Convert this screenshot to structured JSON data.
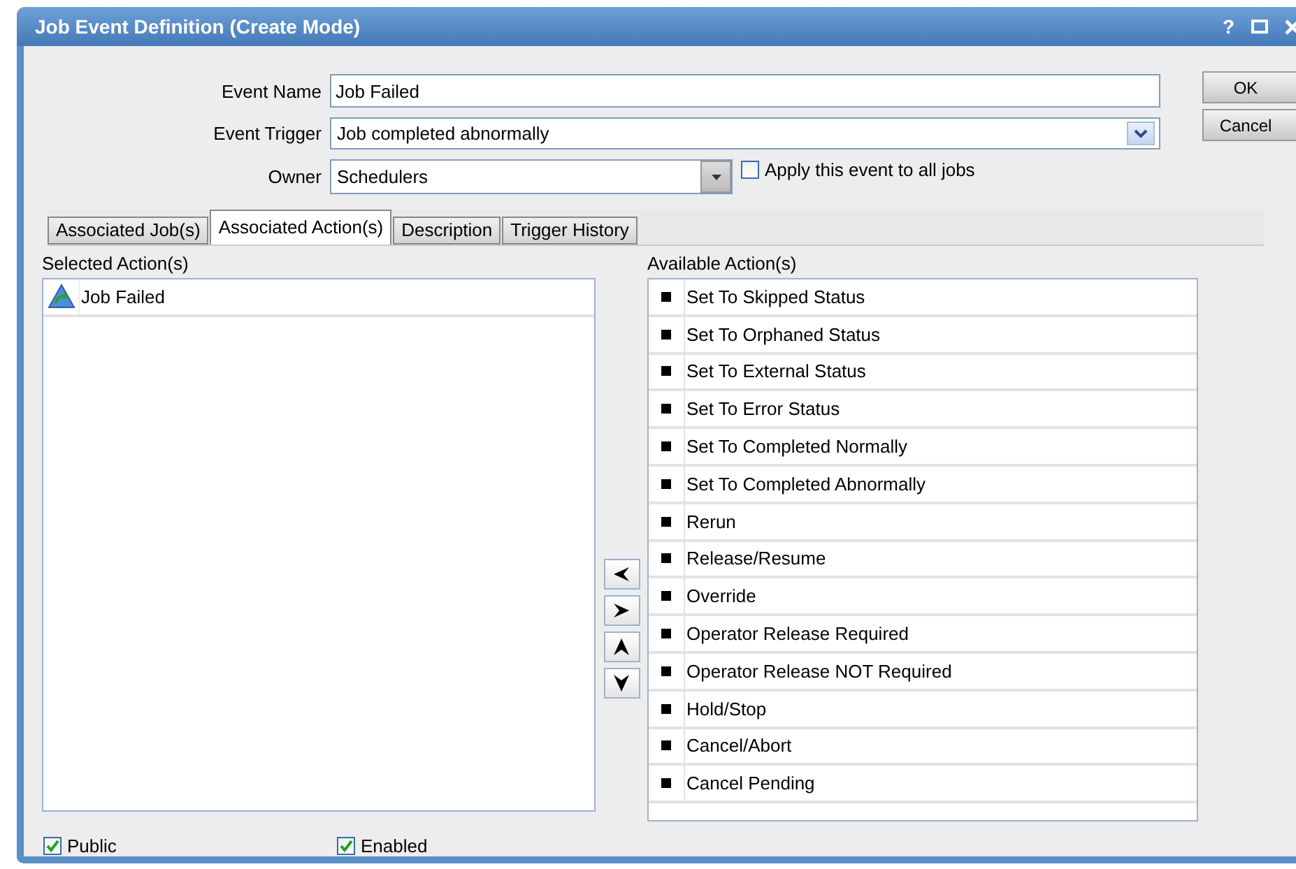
{
  "window": {
    "title": "Job Event Definition (Create Mode)",
    "help": "?"
  },
  "event_name": {
    "label": "Event Name",
    "value": "Job Failed"
  },
  "event_trigger": {
    "label": "Event Trigger",
    "value": "Job completed abnormally"
  },
  "owner": {
    "label": "Owner",
    "value": "Schedulers"
  },
  "apply_to_all": {
    "label": "Apply this event to all jobs",
    "checked": false
  },
  "buttons": [
    "OK",
    "Cancel"
  ],
  "tabs": [
    {
      "label": "Associated Job(s)",
      "selected": false
    },
    {
      "label": "Associated Action(s)",
      "selected": true
    },
    {
      "label": "Description",
      "selected": false
    },
    {
      "label": "Trigger History",
      "selected": false
    }
  ],
  "selected_actions": {
    "label": "Selected Action(s)",
    "items": [
      "Job Failed"
    ]
  },
  "available_actions": {
    "label": "Available Action(s)",
    "items": [
      "Set To Skipped Status",
      "Set To Orphaned Status",
      "Set To External Status",
      "Set To Error Status",
      "Set To Completed Normally",
      "Set To Completed Abnormally",
      "Rerun",
      "Release/Resume",
      "Override",
      "Operator Release Required",
      "Operator Release NOT Required",
      "Hold/Stop",
      "Cancel/Abort",
      "Cancel Pending"
    ]
  },
  "footer_checks": [
    {
      "label": "Public",
      "checked": true
    },
    {
      "label": "Enabled",
      "checked": true
    }
  ]
}
